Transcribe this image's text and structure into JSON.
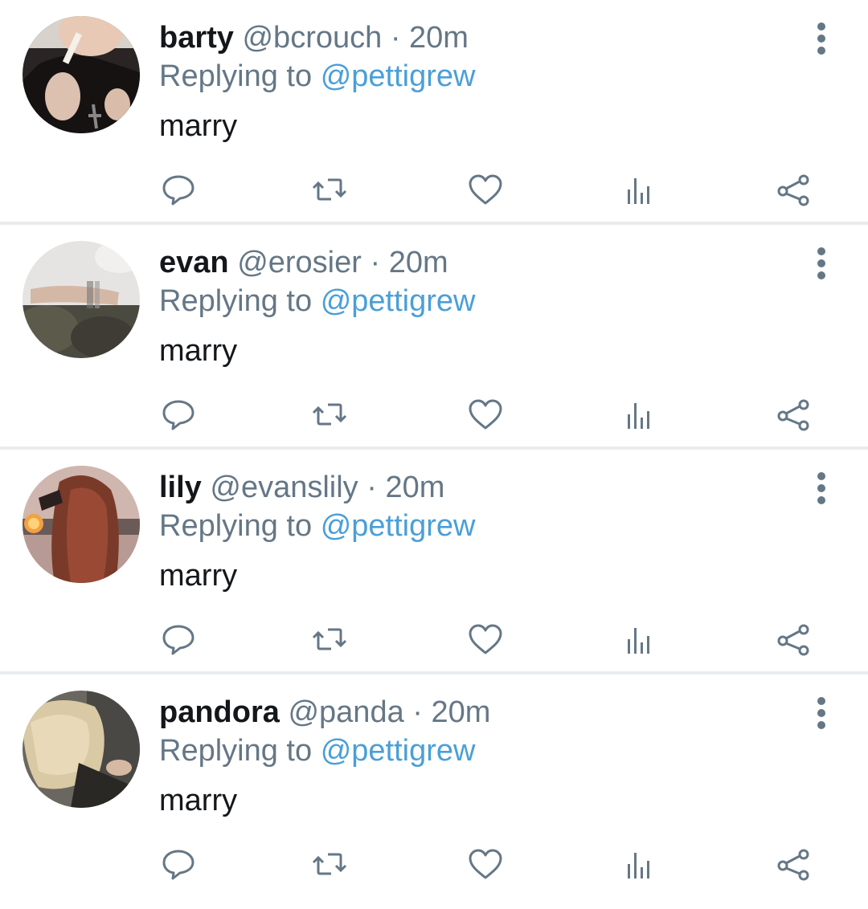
{
  "tweets": [
    {
      "name": "barty",
      "handle": "@bcrouch",
      "separator": "·",
      "time": "20m",
      "replying_prefix": "Replying to",
      "replying_to": "@pettigrew",
      "text": "marry",
      "avatar_icon": "avatar-photo"
    },
    {
      "name": "evan",
      "handle": "@erosier",
      "separator": "·",
      "time": "20m",
      "replying_prefix": "Replying to",
      "replying_to": "@pettigrew",
      "text": "marry",
      "avatar_icon": "avatar-photo"
    },
    {
      "name": "lily",
      "handle": "@evanslily",
      "separator": "·",
      "time": "20m",
      "replying_prefix": "Replying to",
      "replying_to": "@pettigrew",
      "text": "marry",
      "avatar_icon": "avatar-photo"
    },
    {
      "name": "pandora",
      "handle": "@panda",
      "separator": "·",
      "time": "20m",
      "replying_prefix": "Replying to",
      "replying_to": "@pettigrew",
      "text": "marry",
      "avatar_icon": "avatar-photo"
    }
  ],
  "actions": [
    "reply-icon",
    "retweet-icon",
    "like-icon",
    "analytics-icon",
    "share-icon"
  ],
  "colors": {
    "text": "#14171a",
    "secondary": "#657786",
    "mention": "#4a9fd8",
    "divider": "#e9ecef",
    "icon": "#657786"
  }
}
